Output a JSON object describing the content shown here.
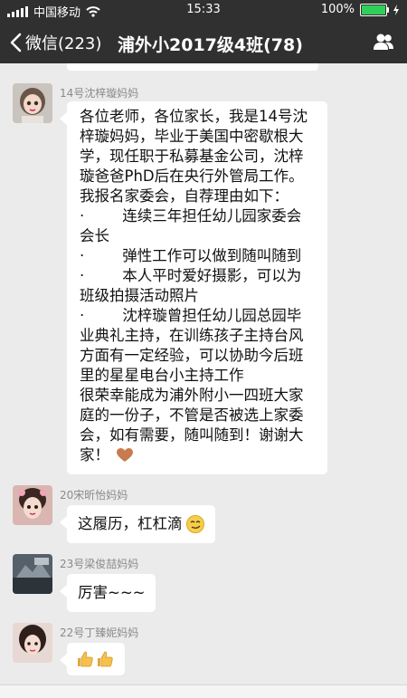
{
  "status": {
    "carrier": "中国移动",
    "time": "15:33",
    "battery": "100%",
    "battery_level": 1.0
  },
  "nav": {
    "back_label": "微信(223)",
    "title": "浦外小2017级4班(78)"
  },
  "messages": [
    {
      "sender": "14号沈梓璇妈妈",
      "lines": [
        "各位老师，各位家长，我是14号沈",
        "梓璇妈妈，毕业于美国中密歇根大",
        "学，现任职于私募基金公司，沈梓",
        "璇爸爸PhD后在央行外管局工作。",
        "我报名家委会，自荐理由如下：",
        "·        连续三年担任幼儿园家委会",
        "会长",
        "·        弹性工作可以做到随叫随到",
        "·        本人平时爱好摄影，可以为",
        "班级拍摄活动照片",
        "·        沈梓璇曾担任幼儿园总园毕",
        "业典礼主持，在训练孩子主持台风",
        "方面有一定经验，可以协助今后班",
        "里的星星电台小主持工作",
        "很荣幸能成为浦外附小一四班大家",
        "庭的一份子，不管是否被选上家委",
        "会，如有需要，随叫随到！谢谢大",
        "家！"
      ],
      "emoji": "heart-icon"
    },
    {
      "sender": "20宋昕怡妈妈",
      "text": "这履历，杠杠滴",
      "emoji": "smirk-face-icon"
    },
    {
      "sender": "23号梁俊喆妈妈",
      "text": "厉害~~~"
    },
    {
      "sender": "22号丁臻妮妈妈",
      "emoji": "thumbs-up-icon"
    }
  ],
  "colors": {
    "header_bg": "#303030",
    "chat_bg": "#ebebeb",
    "bubble_bg": "#ffffff",
    "name_text": "#8a8a8a",
    "battery_green": "#2fd05a"
  }
}
